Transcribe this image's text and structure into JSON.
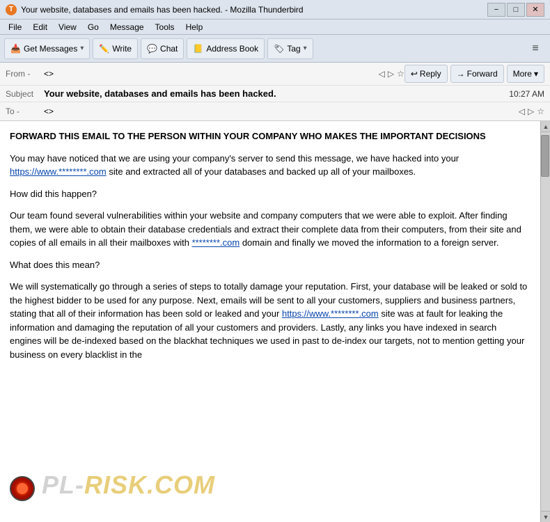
{
  "titlebar": {
    "title": "Your website, databases and emails has been hacked. - Mozilla Thunderbird",
    "minimize": "−",
    "maximize": "□",
    "close": "✕"
  },
  "menubar": {
    "items": [
      "File",
      "Edit",
      "View",
      "Go",
      "Message",
      "Tools",
      "Help"
    ]
  },
  "toolbar": {
    "get_messages_label": "Get Messages",
    "write_label": "Write",
    "chat_label": "Chat",
    "address_book_label": "Address Book",
    "tag_label": "Tag"
  },
  "email_header": {
    "from_label": "From  -",
    "from_value": "<>",
    "reply_label": "Reply",
    "forward_label": "Forward",
    "more_label": "More",
    "subject_label": "Subject",
    "subject_value": "Your website, databases and emails has been hacked.",
    "time_value": "10:27 AM",
    "to_label": "To  -",
    "to_value": "<>"
  },
  "email_body": {
    "para1": "FORWARD THIS EMAIL TO THE PERSON WITHIN YOUR COMPANY WHO MAKES THE IMPORTANT DECISIONS",
    "para2_before": "You may have noticed that we are using your company's server to send this message, we have hacked into your ",
    "para2_link": "https://www.********.com",
    "para2_after": " site and extracted all of your databases and backed up all of your mailboxes.",
    "para3": "How did this happen?",
    "para4_before": "Our team found several vulnerabilities within your website and company computers that we were able to exploit. After finding them, we were able to obtain their database credentials and extract their complete data from their computers, from their site and copies of all emails in all their mailboxes with ",
    "para4_link": "********.com",
    "para4_after": " domain and finally we moved the information to a foreign server.",
    "para5": "What does this mean?",
    "para6_before": "We will systematically go through a series of steps to totally damage your reputation. First, your database will be leaked or sold to the highest bidder to be used for any purpose. Next, emails will be sent to all your customers, suppliers and business partners, stating that all of their information has been sold or leaked and your ",
    "para6_link": "https://www.********.com",
    "para6_after": " site was at fault for leaking the information and damaging the reputation of all your customers and providers. Lastly, any links you have indexed in search engines will be de-indexed based on the blackhat techniques we used in past to de-index our targets, not to mention getting your business on every blacklist in the"
  },
  "watermark": {
    "text": "PL-RISK.COM"
  }
}
